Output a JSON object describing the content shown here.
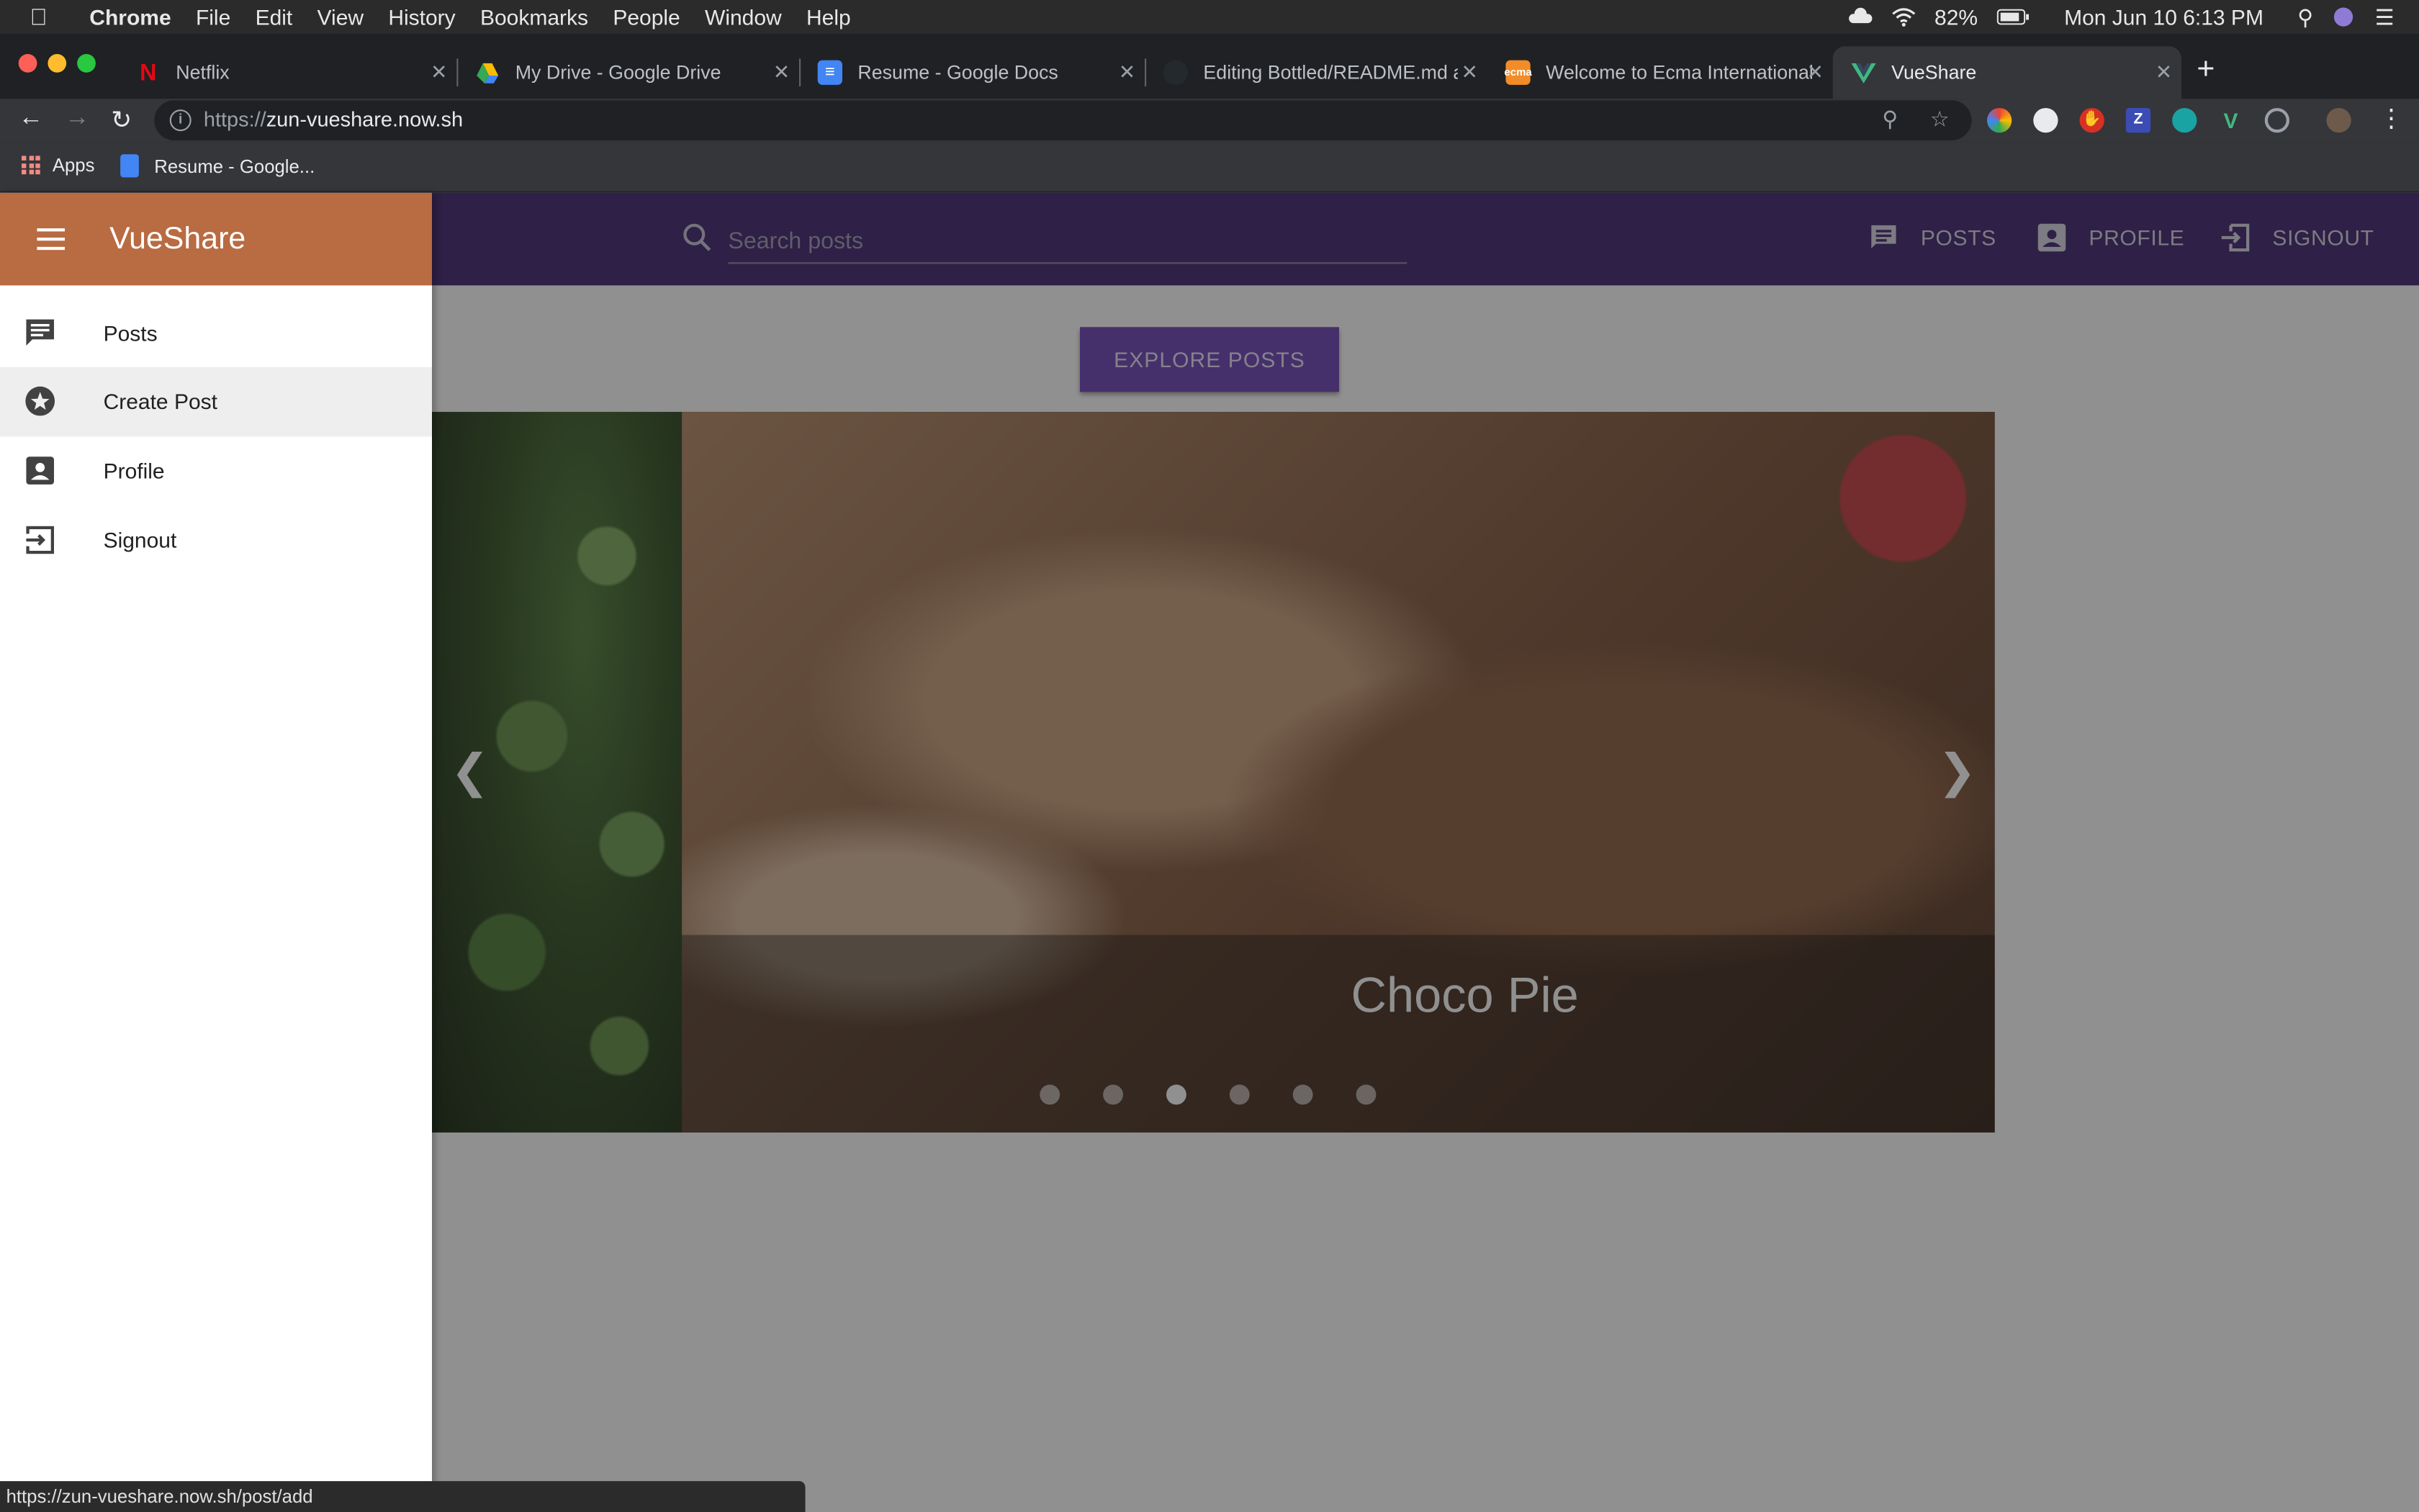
{
  "menubar": {
    "app_name": "Chrome",
    "items": [
      "File",
      "Edit",
      "View",
      "History",
      "Bookmarks",
      "People",
      "Window",
      "Help"
    ],
    "battery": "82%",
    "datetime": "Mon Jun 10  6:13 PM"
  },
  "tabs": [
    {
      "title": "Netflix",
      "icon": "netflix-icon"
    },
    {
      "title": "My Drive - Google Drive",
      "icon": "google-drive-icon"
    },
    {
      "title": "Resume - Google Docs",
      "icon": "google-docs-icon"
    },
    {
      "title": "Editing Bottled/README.md at",
      "icon": "github-icon"
    },
    {
      "title": "Welcome to Ecma International",
      "icon": "ecma-icon"
    },
    {
      "title": "VueShare",
      "icon": "vue-icon",
      "active": true
    }
  ],
  "toolbar": {
    "url_prefix": "https://",
    "url_host": "zun-vueshare.now.sh"
  },
  "bookmarks": {
    "apps_label": "Apps",
    "items": [
      "Resume - Google..."
    ]
  },
  "app": {
    "brand": "VueShare",
    "search": {
      "placeholder": "Search posts"
    },
    "nav": {
      "posts": "POSTS",
      "profile": "PROFILE",
      "signout": "SIGNOUT"
    },
    "explore_label": "EXPLORE POSTS",
    "carousel": {
      "caption": "Choco Pie",
      "slide_count": 6,
      "active_index": 2
    },
    "drawer": {
      "items": [
        {
          "label": "Posts",
          "icon": "chat-icon"
        },
        {
          "label": "Create Post",
          "icon": "star-icon"
        },
        {
          "label": "Profile",
          "icon": "account-box-icon"
        },
        {
          "label": "Signout",
          "icon": "exit-icon"
        }
      ]
    }
  },
  "status": {
    "hover_url": "https://zun-vueshare.now.sh/post/add"
  },
  "colors": {
    "appbar": "#3a1f6a",
    "drawer_header": "#b96b42",
    "explore_button": "#6a3fb5"
  }
}
